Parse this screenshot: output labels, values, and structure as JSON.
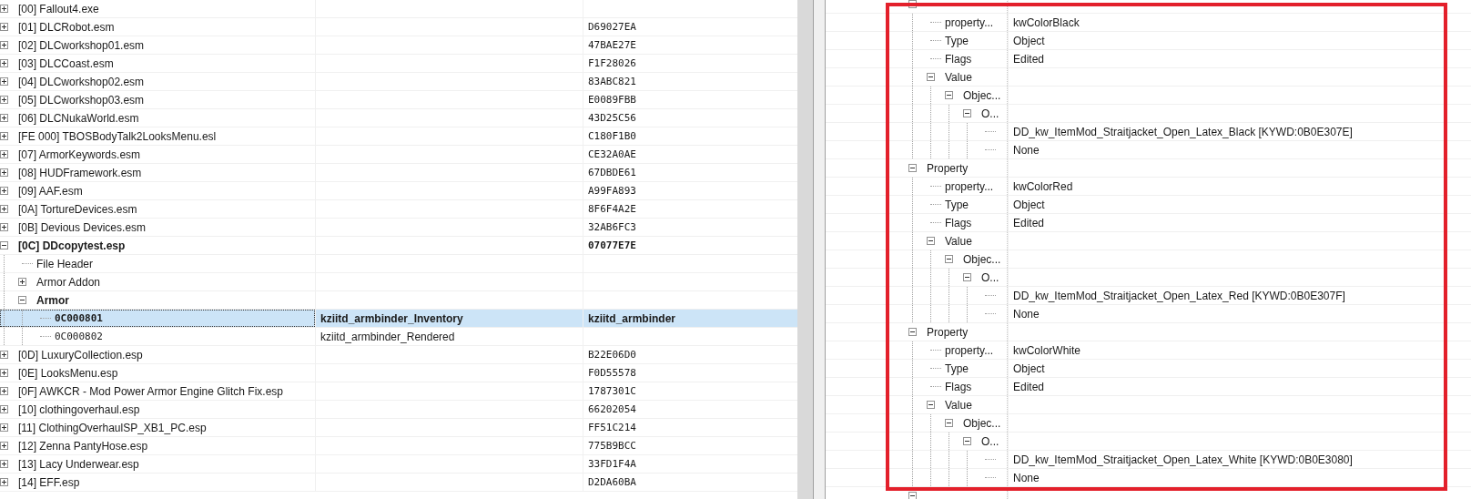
{
  "plugin_tree": [
    {
      "label": "[00] Fallout4.exe",
      "kind": "group",
      "expanded": false,
      "selected": false,
      "bold": false
    },
    {
      "label": "[01] DLCRobot.esm",
      "column_3": "D69027EA",
      "kind": "group",
      "expanded": false,
      "selected": false,
      "bold": false
    },
    {
      "label": "[02] DLCworkshop01.esm",
      "column_3": "47BAE27E",
      "kind": "group",
      "expanded": false,
      "selected": false,
      "bold": false
    },
    {
      "label": "[03] DLCCoast.esm",
      "column_3": "F1F28026",
      "kind": "group",
      "expanded": false,
      "selected": false,
      "bold": false
    },
    {
      "label": "[04] DLCworkshop02.esm",
      "column_3": "83ABC821",
      "kind": "group",
      "expanded": false,
      "selected": false,
      "bold": false
    },
    {
      "label": "[05] DLCworkshop03.esm",
      "column_3": "E0089FBB",
      "kind": "group",
      "expanded": false,
      "selected": false,
      "bold": false
    },
    {
      "label": "[06] DLCNukaWorld.esm",
      "column_3": "43D25C56",
      "kind": "group",
      "expanded": false,
      "selected": false,
      "bold": false
    },
    {
      "label": "[FE 000] TBOSBodyTalk2LooksMenu.esl",
      "column_3": "C180F1B0",
      "kind": "group",
      "expanded": false,
      "selected": false,
      "bold": false
    },
    {
      "label": "[07] ArmorKeywords.esm",
      "column_3": "CE32A0AE",
      "kind": "group",
      "expanded": false,
      "selected": false,
      "bold": false
    },
    {
      "label": "[08] HUDFramework.esm",
      "column_3": "67DBDE61",
      "kind": "group",
      "expanded": false,
      "selected": false,
      "bold": false
    },
    {
      "label": "[09] AAF.esm",
      "column_3": "A99FA893",
      "kind": "group",
      "expanded": false,
      "selected": false,
      "bold": false
    },
    {
      "label": "[0A] TortureDevices.esm",
      "column_3": "8F6F4A2E",
      "kind": "group",
      "expanded": false,
      "selected": false,
      "bold": false
    },
    {
      "label": "[0B] Devious Devices.esm",
      "column_3": "32AB6FC3",
      "kind": "group",
      "expanded": false,
      "selected": false,
      "bold": false
    },
    {
      "label": "[0C] DDcopytest.esp",
      "column_3": "07077E7E",
      "kind": "group",
      "expanded": true,
      "selected": false,
      "bold": true,
      "children": [
        {
          "label": "File Header",
          "kind": "leaf",
          "selected": false,
          "bold": false
        },
        {
          "label": "Armor Addon",
          "kind": "group",
          "expanded": false,
          "selected": false,
          "bold": false
        },
        {
          "label": "Armor",
          "kind": "group",
          "expanded": true,
          "selected": false,
          "bold": true,
          "children": [
            {
              "label": "0C000801",
              "column_2": "kziitd_armbinder_Inventory",
              "column_3": "kziitd_armbinder",
              "kind": "record",
              "selected": true,
              "bold": true
            },
            {
              "label": "0C000802",
              "column_2": "kziitd_armbinder_Rendered",
              "kind": "record",
              "selected": false,
              "bold": false
            }
          ]
        }
      ]
    },
    {
      "label": "[0D] LuxuryCollection.esp",
      "column_3": "B22E06D0",
      "kind": "group",
      "expanded": false,
      "selected": false,
      "bold": false
    },
    {
      "label": "[0E] LooksMenu.esp",
      "column_3": "F0D55578",
      "kind": "group",
      "expanded": false,
      "selected": false,
      "bold": false
    },
    {
      "label": "[0F] AWKCR - Mod Power Armor Engine Glitch Fix.esp",
      "column_3": "1787301C",
      "kind": "group",
      "expanded": false,
      "selected": false,
      "bold": false
    },
    {
      "label": "[10] clothingoverhaul.esp",
      "column_3": "66202054",
      "kind": "group",
      "expanded": false,
      "selected": false,
      "bold": false
    },
    {
      "label": "[11] ClothingOverhaulSP_XB1_PC.esp",
      "column_3": "FF51C214",
      "kind": "group",
      "expanded": false,
      "selected": false,
      "bold": false
    },
    {
      "label": "[12] Zenna PantyHose.esp",
      "column_3": "775B9BCC",
      "kind": "group",
      "expanded": false,
      "selected": false,
      "bold": false
    },
    {
      "label": "[13] Lacy Underwear.esp",
      "column_3": "33FD1F4A",
      "kind": "group",
      "expanded": false,
      "selected": false,
      "bold": false
    },
    {
      "label": "[14] EFF.esp",
      "column_3": "D2DA60BA",
      "kind": "group",
      "expanded": false,
      "selected": false,
      "bold": false
    }
  ],
  "record_tree": [
    {
      "kind": "group",
      "expanded": true,
      "children": [
        {
          "name": "property...",
          "value": "kwColorBlack",
          "kind": "leaf"
        },
        {
          "name": "Type",
          "value": "Object",
          "kind": "leaf"
        },
        {
          "name": "Flags",
          "value": "Edited",
          "kind": "leaf"
        },
        {
          "name": "Value",
          "kind": "group",
          "expanded": true,
          "children": [
            {
              "name": "Objec...",
              "kind": "group",
              "expanded": true,
              "children": [
                {
                  "name": "O...",
                  "kind": "group",
                  "expanded": true,
                  "children": [
                    {
                      "value": "DD_kw_ItemMod_Straitjacket_Open_Latex_Black [KYWD:0B0E307E]",
                      "kind": "leaf"
                    },
                    {
                      "value": "None",
                      "kind": "leaf"
                    }
                  ]
                }
              ]
            }
          ]
        }
      ]
    },
    {
      "name": "Property",
      "kind": "group",
      "expanded": true,
      "children": [
        {
          "name": "property...",
          "value": "kwColorRed",
          "kind": "leaf"
        },
        {
          "name": "Type",
          "value": "Object",
          "kind": "leaf"
        },
        {
          "name": "Flags",
          "value": "Edited",
          "kind": "leaf"
        },
        {
          "name": "Value",
          "kind": "group",
          "expanded": true,
          "children": [
            {
              "name": "Objec...",
              "kind": "group",
              "expanded": true,
              "children": [
                {
                  "name": "O...",
                  "kind": "group",
                  "expanded": true,
                  "children": [
                    {
                      "value": "DD_kw_ItemMod_Straitjacket_Open_Latex_Red [KYWD:0B0E307F]",
                      "kind": "leaf"
                    },
                    {
                      "value": "None",
                      "kind": "leaf"
                    }
                  ]
                }
              ]
            }
          ]
        }
      ]
    },
    {
      "name": "Property",
      "kind": "group",
      "expanded": true,
      "children": [
        {
          "name": "property...",
          "value": "kwColorWhite",
          "kind": "leaf"
        },
        {
          "name": "Type",
          "value": "Object",
          "kind": "leaf"
        },
        {
          "name": "Flags",
          "value": "Edited",
          "kind": "leaf"
        },
        {
          "name": "Value",
          "kind": "group",
          "expanded": true,
          "children": [
            {
              "name": "Objec...",
              "kind": "group",
              "expanded": true,
              "children": [
                {
                  "name": "O...",
                  "kind": "group",
                  "expanded": true,
                  "children": [
                    {
                      "value": "DD_kw_ItemMod_Straitjacket_Open_Latex_White [KYWD:0B0E3080]",
                      "kind": "leaf"
                    },
                    {
                      "value": "None",
                      "kind": "leaf"
                    }
                  ]
                }
              ]
            }
          ]
        }
      ]
    },
    {
      "kind": "group",
      "expanded": true
    }
  ],
  "annotation": {
    "kind": "highlight-box",
    "color": "#e3202b"
  }
}
